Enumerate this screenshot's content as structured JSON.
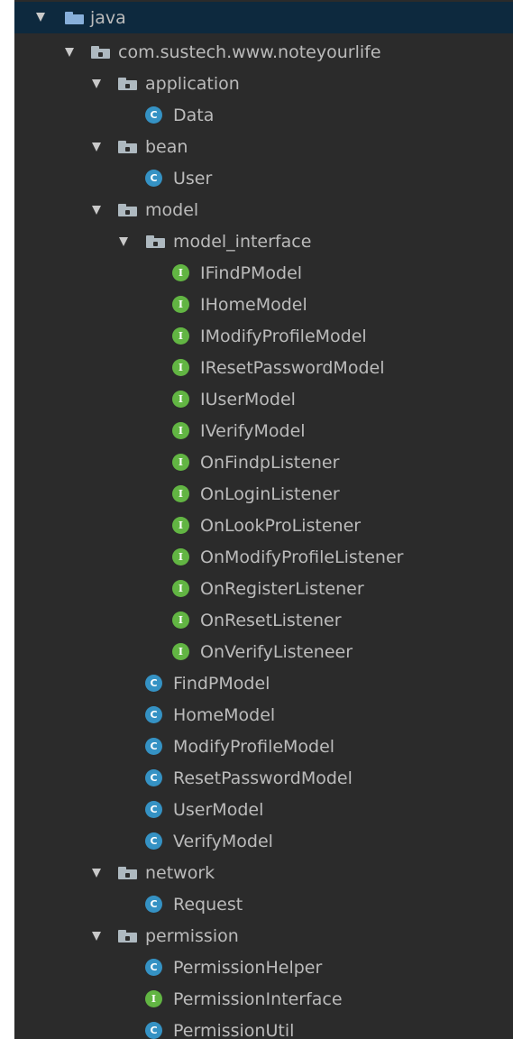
{
  "tree": {
    "root": {
      "label": "java"
    },
    "package": {
      "label": "com.sustech.www.noteyourlife"
    },
    "application": {
      "label": "application",
      "children": [
        "Data"
      ]
    },
    "bean": {
      "label": "bean",
      "children": [
        "User"
      ]
    },
    "model": {
      "label": "model",
      "model_interface": {
        "label": "model_interface",
        "children": [
          "IFindPModel",
          "IHomeModel",
          "IModifyProfileModel",
          "IResetPasswordModel",
          "IUserModel",
          "IVerifyModel",
          "OnFindpListener",
          "OnLoginListener",
          "OnLookProListener",
          "OnModifyProfileListener",
          "OnRegisterListener",
          "OnResetListener",
          "OnVerifyListeneer"
        ]
      },
      "children": [
        "FindPModel",
        "HomeModel",
        "ModifyProfileModel",
        "ResetPasswordModel",
        "UserModel",
        "VerifyModel"
      ]
    },
    "network": {
      "label": "network",
      "children": [
        "Request"
      ]
    },
    "permission": {
      "label": "permission",
      "children": [
        "PermissionHelper",
        "PermissionInterface",
        "PermissionUtil"
      ]
    }
  },
  "icons": {
    "class_glyph": "C",
    "interface_glyph": "I",
    "class_color": "#3592c4",
    "interface_color": "#62b543",
    "folder_color": "#aeb9c0",
    "source_root_color": "#87afda"
  },
  "theme": {
    "background": "#2b2b2b",
    "selected_row": "#0d293e",
    "text": "#bbbbbb"
  }
}
